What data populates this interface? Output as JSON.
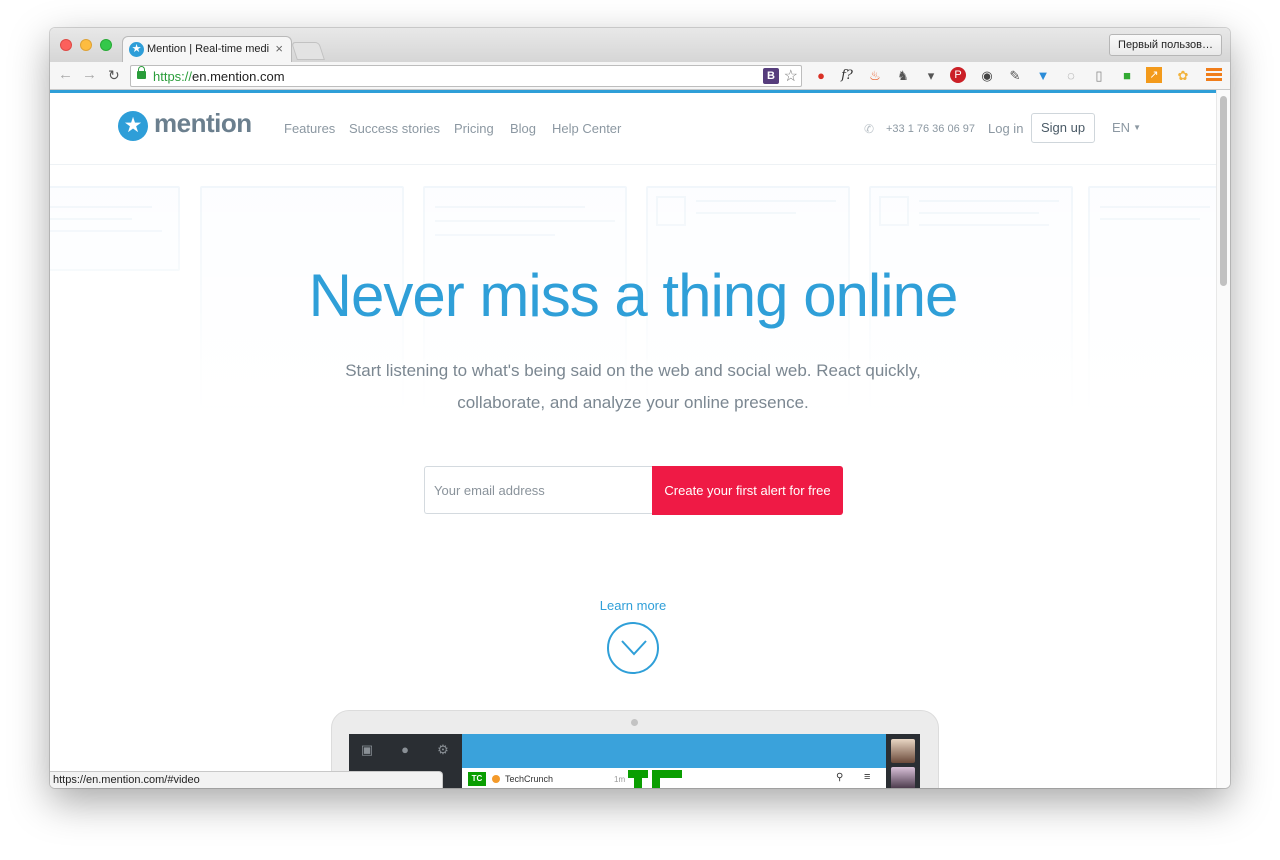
{
  "browser": {
    "tab_title": "Mention | Real-time media",
    "tab_close": "×",
    "profile_button": "Первый пользов…",
    "url_scheme": "https://",
    "url_rest": "en.mention.com",
    "status_url": "https://en.mention.com/#video",
    "accent_color": "#2f9fd8"
  },
  "header": {
    "logo_text": "mention",
    "nav": [
      "Features",
      "Success stories",
      "Pricing",
      "Blog",
      "Help Center"
    ],
    "phone": "+33 1 76 36 06 97",
    "login": "Log in",
    "signup": "Sign up",
    "language": "EN"
  },
  "hero": {
    "headline": "Never miss a thing online",
    "subline_1": "Start listening to what's being said on the web and social web. React quickly,",
    "subline_2": "collaborate, and analyze your online presence.",
    "email_placeholder": "Your email address",
    "cta_label": "Create your first alert for free",
    "cta_color": "#ef1a45",
    "learn_more": "Learn more"
  },
  "app_preview": {
    "source_name": "TechCrunch",
    "source_time": "1m",
    "source_logo": "TC"
  }
}
